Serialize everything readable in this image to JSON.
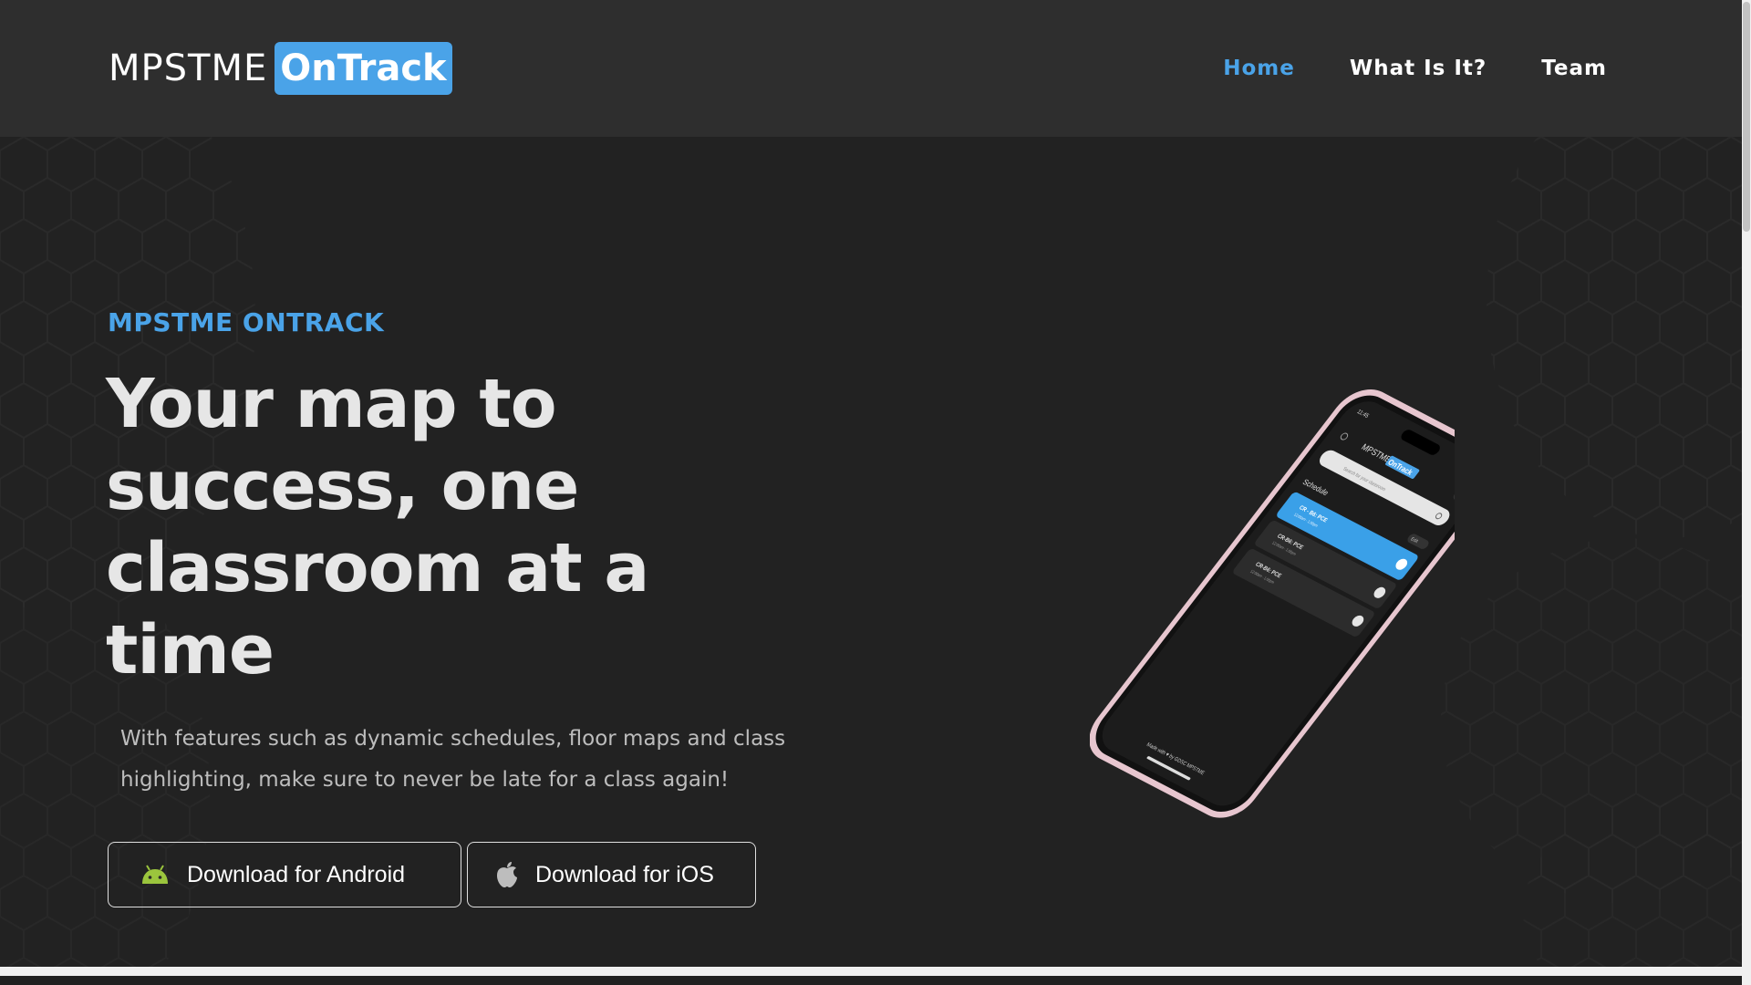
{
  "navbar": {
    "logo_text": "MPSTME",
    "logo_badge": "OnTrack",
    "links": [
      {
        "label": "Home",
        "active": true
      },
      {
        "label": "What Is It?",
        "active": false
      },
      {
        "label": "Team",
        "active": false
      }
    ]
  },
  "hero": {
    "eyebrow": "MPSTME ONTRACK",
    "headline_lines": [
      "Your map to",
      "success, one",
      "classroom at a",
      "time"
    ],
    "description_lines": [
      "With features such as dynamic schedules, floor maps and class",
      "highlighting, make sure to never be late for a class again!"
    ],
    "buttons": {
      "android": {
        "label": "Download for Android",
        "icon": "android-icon"
      },
      "ios": {
        "label": "Download for iOS",
        "icon": "apple-icon"
      }
    }
  },
  "phone_screen": {
    "time": "11:45",
    "logo_text": "MPSTME",
    "logo_badge": "OnTrack",
    "search_placeholder": "Search for your classroom",
    "schedule_title": "Schedule",
    "edit_label": "Edit",
    "classes": [
      {
        "title": "CR - B6: PCE",
        "time": "12:00am - 1:00pm",
        "highlighted": true
      },
      {
        "title": "CR-B6: PCE",
        "time": "12:00am - 1:00pm",
        "highlighted": false
      },
      {
        "title": "CR-B6: PCE",
        "time": "12:00am - 1:00pm",
        "highlighted": false
      }
    ],
    "footer": "Made with ♥ by GDSC MPSTME"
  },
  "colors": {
    "accent": "#4aa3e8",
    "background": "#222222",
    "navbar": "#2e2e2e",
    "android_green": "#9bc53d",
    "phone_frame": "#e7c6cf"
  }
}
